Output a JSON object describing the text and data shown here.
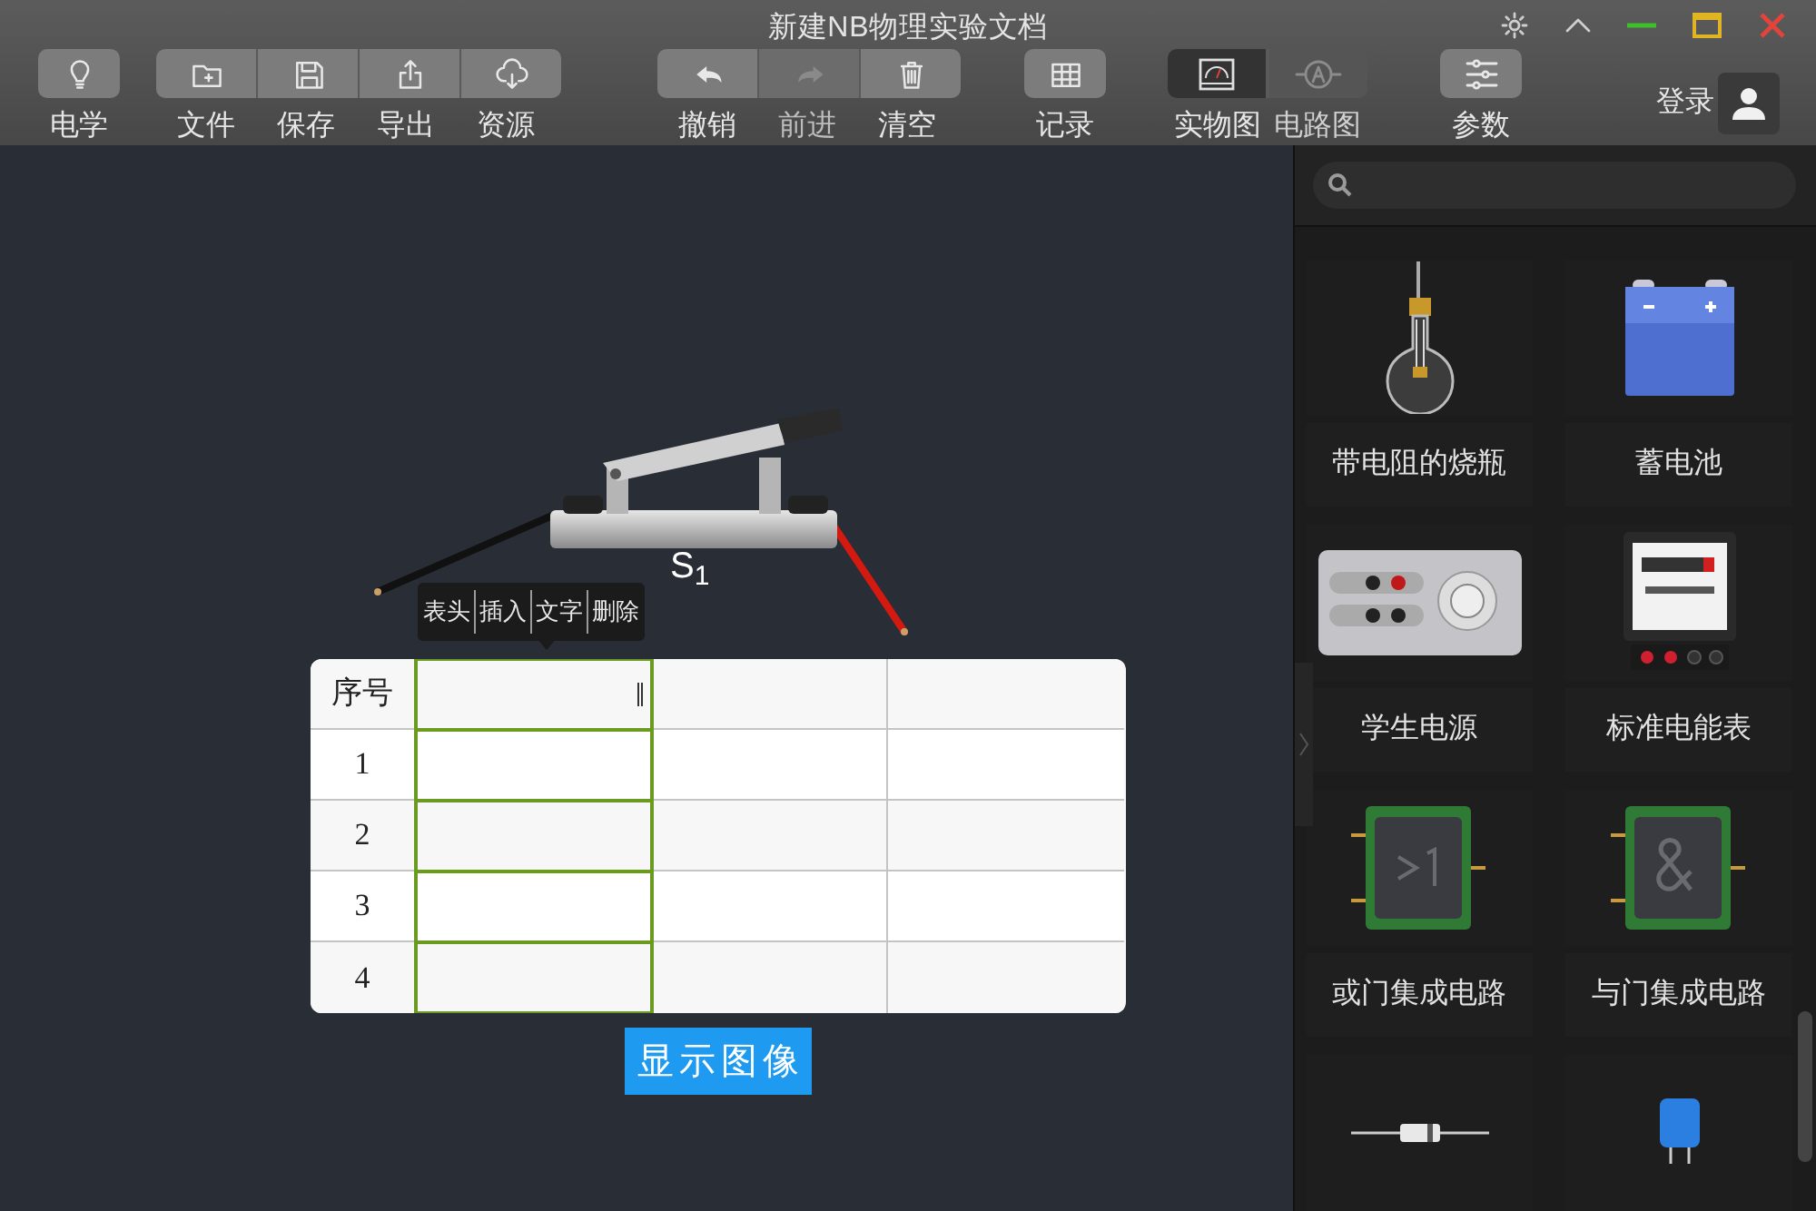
{
  "window": {
    "title": "新建NB物理实验文档"
  },
  "toolbar": {
    "groups": [
      {
        "buttons": [
          {
            "label": "电学",
            "disabled": false
          }
        ]
      },
      {
        "buttons": [
          {
            "label": "文件",
            "disabled": false
          },
          {
            "label": "保存",
            "disabled": false
          },
          {
            "label": "导出",
            "disabled": false
          },
          {
            "label": "资源",
            "disabled": false
          }
        ]
      },
      {
        "buttons": [
          {
            "label": "撤销",
            "disabled": false
          },
          {
            "label": "前进",
            "disabled": true
          },
          {
            "label": "清空",
            "disabled": false
          }
        ]
      },
      {
        "buttons": [
          {
            "label": "记录",
            "disabled": false
          }
        ]
      }
    ],
    "view_toggle": [
      {
        "label": "实物图",
        "selected": true
      },
      {
        "label": "电路图",
        "selected": false
      }
    ],
    "settings_button": {
      "label": "参数"
    },
    "login": {
      "label": "登录"
    }
  },
  "canvas": {
    "switch": {
      "label": "S$_{1}$"
    },
    "context_menu": [
      "表头",
      "插入",
      "文字",
      "删除"
    ],
    "table": {
      "columns": [
        {
          "kind": "index",
          "header": "序号",
          "selected": false
        },
        {
          "kind": "data",
          "selected": true
        },
        {
          "kind": "data",
          "selected": false
        },
        {
          "kind": "data",
          "selected": false
        }
      ],
      "rows": [
        {
          "number": "1"
        },
        {
          "number": "2"
        },
        {
          "number": "3"
        },
        {
          "number": "4"
        }
      ]
    },
    "show_chart_button": "显示图像"
  },
  "sidebar": {
    "items": [
      {
        "kind": "flask",
        "label": "带电阻的烧瓶"
      },
      {
        "kind": "battery",
        "label": "蓄电池"
      },
      {
        "kind": "power-supply",
        "label": "学生电源"
      },
      {
        "kind": "energy-meter",
        "label": "标准电能表"
      },
      {
        "kind": "or-chip",
        "label": "或门集成电路"
      },
      {
        "kind": "and-chip",
        "label": "与门集成电路"
      },
      {
        "kind": "resistor"
      },
      {
        "kind": "capacitor"
      }
    ]
  }
}
